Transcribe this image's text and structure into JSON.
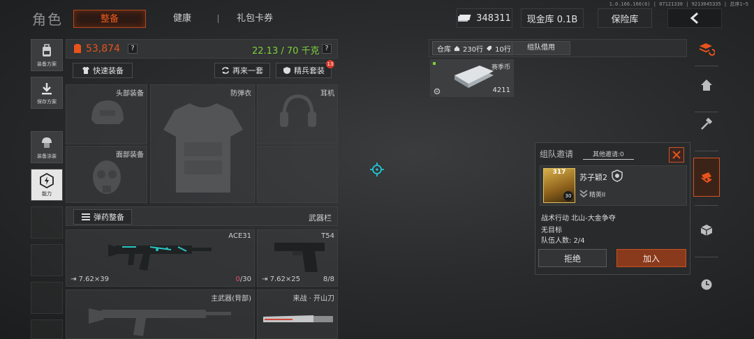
{
  "version": "1.0.166.166(6) | 07121330 | 9213045335 | 总序1~5",
  "header": {
    "title": "角色",
    "tabs": [
      {
        "label": "整备",
        "active": true
      },
      {
        "label": "健康",
        "active": false
      },
      {
        "label": "礼包卡券",
        "active": false
      }
    ],
    "currency_value": "348311",
    "cash_vault": "现金库 0.1B",
    "safe_box": "保险库"
  },
  "left_tools": [
    {
      "label": "装备方案",
      "icon": "backpack-icon"
    },
    {
      "label": "保存方案",
      "icon": "download-icon"
    },
    {
      "label": "装备涂装",
      "icon": "soldier-helmet-icon"
    },
    {
      "label": "能力",
      "icon": "ability-icon",
      "active": true
    }
  ],
  "loadout": {
    "value": "53,874",
    "weight": "22.13 / 70 千克",
    "quick_equip": "快速装备",
    "again": "再来一套",
    "elite": "精兵套装",
    "elite_badge": "13",
    "slots": {
      "head": "头部装备",
      "armor": "防弹衣",
      "headset": "耳机",
      "face": "面部装备"
    },
    "ammo_button": "弹药整备",
    "weapon_bar": "武器栏",
    "primary_weapon": {
      "name": "ACE31",
      "ammo_type": "7.62×39",
      "ammo_cur": "0",
      "ammo_max": "/30"
    },
    "sidearm": {
      "name": "T54",
      "ammo_type": "7.62×25",
      "ammo": "8/8"
    },
    "back_weapon": "主武器(背部)",
    "melee": "来战 · 开山刀"
  },
  "warehouse": {
    "tab_label": "仓库",
    "rows_a": "230行",
    "rows_b": "10行",
    "team_borrow": "组队借用",
    "item": {
      "name": "赛季币",
      "count": "4211"
    }
  },
  "invite": {
    "title": "组队邀请",
    "other_invites": "其他邀请:0",
    "player_name": "苏子颖2",
    "level": "317",
    "badge_level": "30",
    "rank": "精英II",
    "operation": "战术行动 北山-大金争夺",
    "objective": "无目标",
    "team_size": "队伍人数: 2/4",
    "reject": "拒绝",
    "join": "加入"
  },
  "colors": {
    "accent": "#e8531c",
    "green": "#7fd23b",
    "crosshair": "#1fc6d6"
  }
}
